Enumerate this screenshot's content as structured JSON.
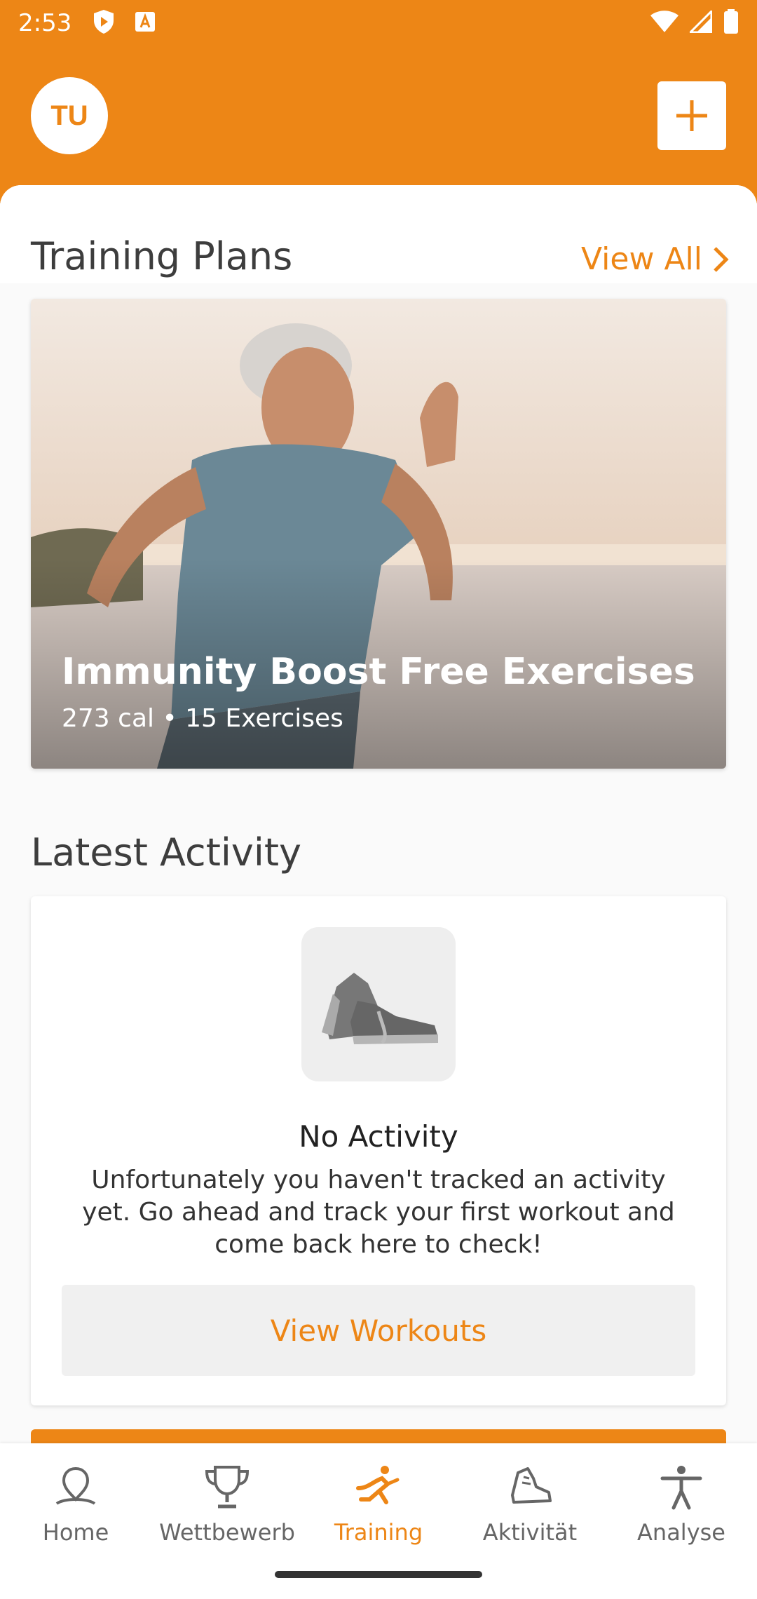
{
  "status_bar": {
    "time": "2:53"
  },
  "header": {
    "avatar_initials": "TU"
  },
  "training_plans": {
    "title": "Training Plans",
    "view_all_label": "View All",
    "card": {
      "title": "Immunity Boost Free Exercises",
      "meta": "273 cal • 15 Exercises"
    }
  },
  "latest_activity": {
    "title": "Latest Activity",
    "empty_title": "No Activity",
    "empty_description": "Unfortunately you haven't tracked an activity yet. Go ahead and track your first workout and come back here to check!",
    "button_label": "View Workouts"
  },
  "bottom_nav": {
    "items": [
      {
        "label": "Home",
        "icon": "home-icon"
      },
      {
        "label": "Wettbewerb",
        "icon": "trophy-icon"
      },
      {
        "label": "Training",
        "icon": "running-icon"
      },
      {
        "label": "Aktivität",
        "icon": "shoe-icon"
      },
      {
        "label": "Analyse",
        "icon": "person-icon"
      }
    ],
    "active_index": 2
  },
  "colors": {
    "accent": "#ED8616"
  }
}
